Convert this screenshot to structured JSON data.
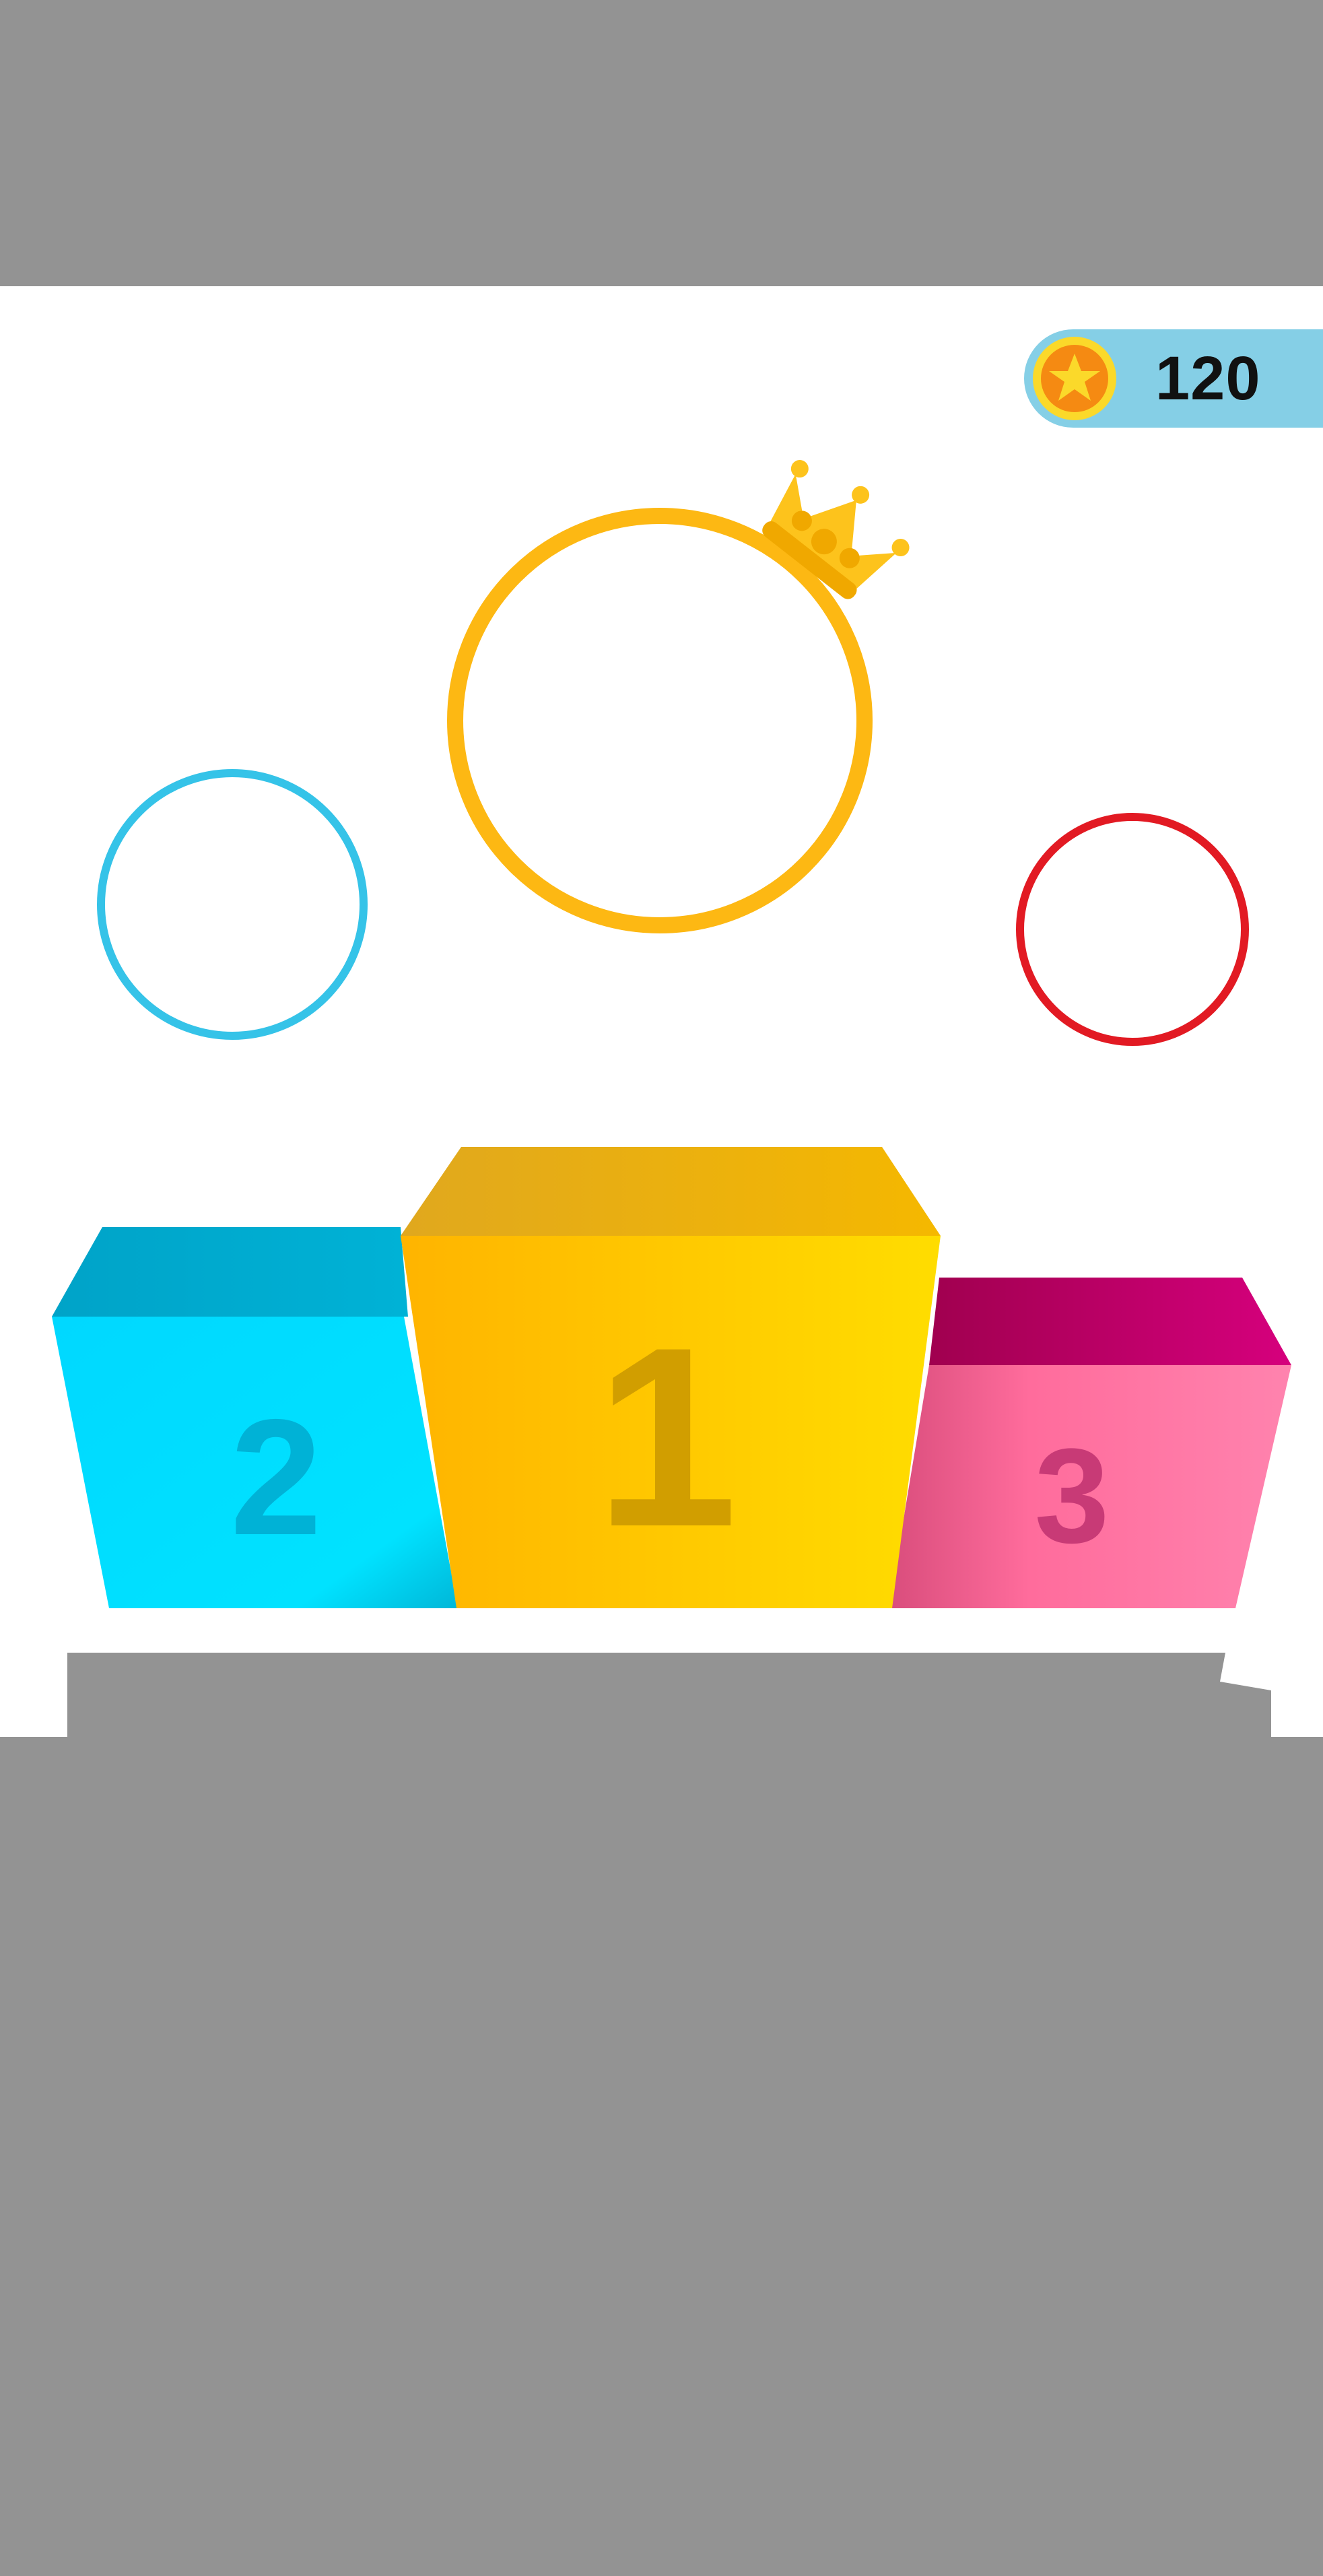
{
  "hud": {
    "coins": "120",
    "coin_icon": "star-coin-icon"
  },
  "players": [
    {
      "place": 1,
      "color": "#fdb813",
      "crown": true
    },
    {
      "place": 2,
      "color": "#35c3e8",
      "crown": false
    },
    {
      "place": 3,
      "color": "#e21a23",
      "crown": false
    }
  ],
  "podium": [
    {
      "place": 1,
      "label": "1"
    },
    {
      "place": 2,
      "label": "2"
    },
    {
      "place": 3,
      "label": "3"
    }
  ],
  "colors": {
    "background": "#939393",
    "play_area": "#ffffff",
    "coin_bar": "#85cfe6",
    "gold": "#fdb813",
    "cyan": "#00d4ff",
    "pink": "#ff7aa8"
  }
}
